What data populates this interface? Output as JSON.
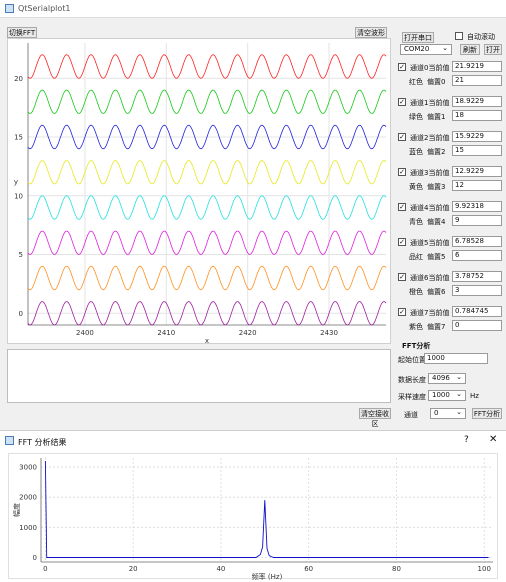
{
  "window": {
    "title": "QtSerialplot1"
  },
  "toolbar": {
    "switch_fft_label": "切换FFT",
    "clear_plot_label": "清空波形"
  },
  "plot": {
    "x_ticks": [
      "2400",
      "2410",
      "2420",
      "2430"
    ],
    "y_ticks": [
      "20",
      "15",
      "10",
      "5",
      "0"
    ],
    "xlabel": "x",
    "ylabel": "y",
    "colors": [
      "#ff2020",
      "#18c818",
      "#2020e0",
      "#e8e820",
      "#20e0e0",
      "#e020e0",
      "#ff9020",
      "#a020a0"
    ]
  },
  "chart_data": {
    "type": "line",
    "title": "",
    "xlabel": "x",
    "ylabel": "y",
    "xlim": [
      2393,
      2437
    ],
    "ylim": [
      -1,
      23
    ],
    "series": [
      {
        "baseline": 21,
        "amplitude": 1,
        "period": 3,
        "color": "#ff2020"
      },
      {
        "baseline": 18,
        "amplitude": 1,
        "period": 3,
        "color": "#18c818"
      },
      {
        "baseline": 15,
        "amplitude": 1,
        "period": 3,
        "color": "#2020e0"
      },
      {
        "baseline": 12,
        "amplitude": 1,
        "period": 3,
        "color": "#e8e820"
      },
      {
        "baseline": 9,
        "amplitude": 1,
        "period": 3,
        "color": "#20e0e0"
      },
      {
        "baseline": 6,
        "amplitude": 1,
        "period": 3,
        "color": "#e020e0"
      },
      {
        "baseline": 3,
        "amplitude": 1,
        "period": 3,
        "color": "#ff9020"
      },
      {
        "baseline": 0,
        "amplitude": 1,
        "period": 3,
        "color": "#a020a0"
      }
    ]
  },
  "serial": {
    "open_label": "打开串口",
    "auto_scroll_label": "自动滚动",
    "port": "COM20",
    "refresh_label": "刷新",
    "open_btn_label": "打开"
  },
  "channels": [
    {
      "label": "通道0当前值",
      "value": "21.9219",
      "color_name": "红色",
      "offset_label": "偏置0",
      "offset": "21",
      "checked": true
    },
    {
      "label": "通道1当前值",
      "value": "18.9229",
      "color_name": "绿色",
      "offset_label": "偏置1",
      "offset": "18",
      "checked": true
    },
    {
      "label": "通道2当前值",
      "value": "15.9229",
      "color_name": "蓝色",
      "offset_label": "偏置2",
      "offset": "15",
      "checked": true
    },
    {
      "label": "通道3当前值",
      "value": "12.9229",
      "color_name": "黄色",
      "offset_label": "偏置3",
      "offset": "12",
      "checked": true
    },
    {
      "label": "通道4当前值",
      "value": "9.92318",
      "color_name": "青色",
      "offset_label": "偏置4",
      "offset": "9",
      "checked": true
    },
    {
      "label": "通道5当前值",
      "value": "6.78528",
      "color_name": "品红",
      "offset_label": "偏置5",
      "offset": "6",
      "checked": true
    },
    {
      "label": "通道6当前值",
      "value": "3.78752",
      "color_name": "橙色",
      "offset_label": "偏置6",
      "offset": "3",
      "checked": true
    },
    {
      "label": "通道7当前值",
      "value": "0.784745",
      "color_name": "紫色",
      "offset_label": "偏置7",
      "offset": "0",
      "checked": true
    }
  ],
  "fft_settings": {
    "section_title": "FFT分析",
    "start_pos_label": "起始位置",
    "start_pos_value": "1000",
    "length_label": "数据长度",
    "length_value": "4096",
    "rate_label": "采样速度",
    "rate_value": "1000",
    "rate_unit": "Hz",
    "clear_recv_label": "清空接收区",
    "channel_label": "通道",
    "channel_value": "0",
    "analyze_label": "FFT分析"
  },
  "fft_window": {
    "title": "FFT 分析结果",
    "help_label": "?",
    "close_label": "✕",
    "y_ticks": [
      "3000",
      "2000",
      "1000",
      "0"
    ],
    "x_ticks": [
      "0",
      "20",
      "40",
      "60",
      "80",
      "100"
    ],
    "ylabel": "幅度",
    "xlabel": "频率 (Hz)"
  },
  "fft_chart_data": {
    "type": "line",
    "xlabel": "频率 (Hz)",
    "ylabel": "幅度",
    "xlim": [
      -1,
      102
    ],
    "ylim": [
      -150,
      3300
    ],
    "points": [
      [
        0,
        3200
      ],
      [
        0.3,
        0
      ],
      [
        48,
        0
      ],
      [
        49,
        100
      ],
      [
        49.5,
        350
      ],
      [
        50,
        1900
      ],
      [
        50.5,
        300
      ],
      [
        51,
        60
      ],
      [
        52,
        0
      ],
      [
        101,
        0
      ]
    ]
  }
}
